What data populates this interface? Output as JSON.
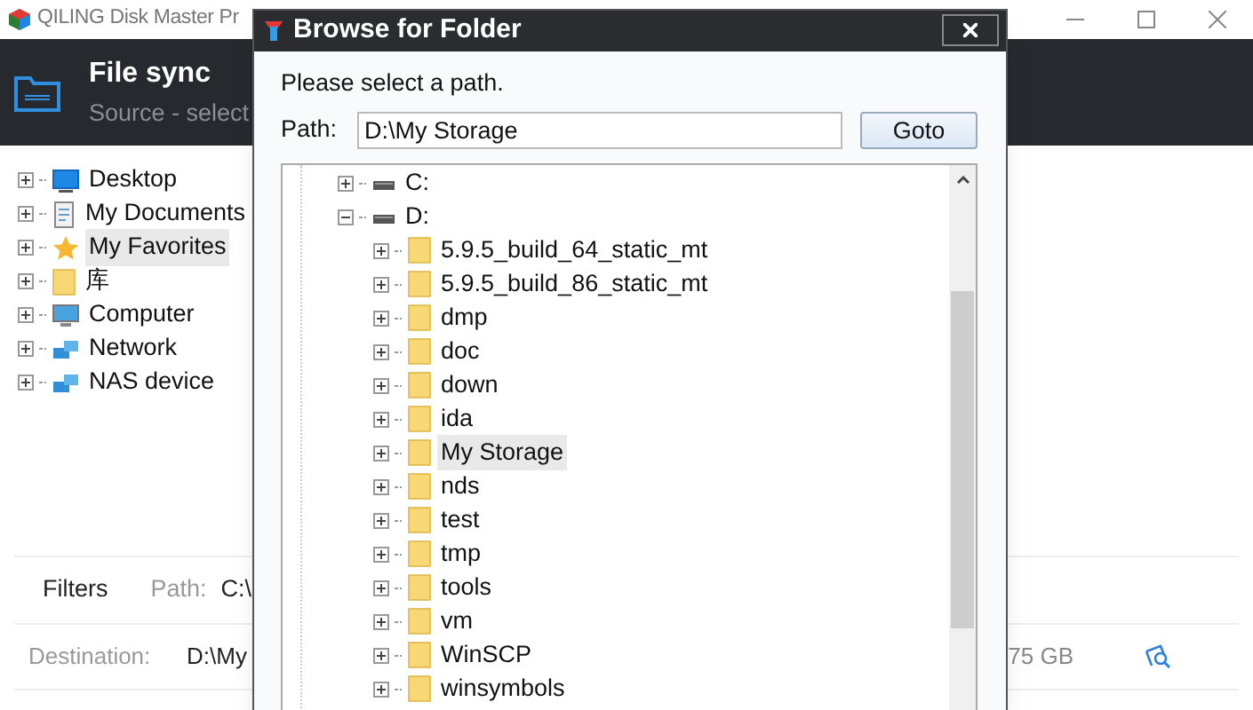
{
  "app_window": {
    "title": "QILING Disk Master Pr",
    "header": {
      "title": "File sync",
      "subtitle": "Source - select"
    },
    "tree": [
      {
        "label": "Desktop",
        "kind": "desktop",
        "expanded": false,
        "selected": false
      },
      {
        "label": "My Documents",
        "kind": "documents",
        "expanded": false,
        "selected": false
      },
      {
        "label": "My Favorites",
        "kind": "favorites",
        "expanded": false,
        "selected": true
      },
      {
        "label": "库",
        "kind": "folder",
        "expanded": false,
        "selected": false
      },
      {
        "label": "Computer",
        "kind": "computer",
        "expanded": false,
        "selected": false
      },
      {
        "label": "Network",
        "kind": "network",
        "expanded": false,
        "selected": false
      },
      {
        "label": "NAS device",
        "kind": "network",
        "expanded": false,
        "selected": false
      }
    ],
    "filters": {
      "label": "Filters",
      "path_label": "Path:",
      "path_value": "C:\\"
    },
    "destination": {
      "label": "Destination:",
      "value": "D:\\My",
      "size": "75 GB"
    }
  },
  "dialog": {
    "title": "Browse for Folder",
    "prompt": "Please select a path.",
    "path": {
      "label": "Path:",
      "value": "D:\\My Storage"
    },
    "goto_button": "Goto",
    "tree": [
      {
        "label": "C:",
        "kind": "drive",
        "expanded": false,
        "selected": false
      },
      {
        "label": "D:",
        "kind": "drive",
        "expanded": true,
        "selected": false,
        "children": [
          {
            "label": "5.9.5_build_64_static_mt",
            "kind": "folder",
            "expanded": false,
            "selected": false
          },
          {
            "label": "5.9.5_build_86_static_mt",
            "kind": "folder",
            "expanded": false,
            "selected": false
          },
          {
            "label": "dmp",
            "kind": "folder",
            "expanded": false,
            "selected": false
          },
          {
            "label": "doc",
            "kind": "folder",
            "expanded": false,
            "selected": false
          },
          {
            "label": "down",
            "kind": "folder",
            "expanded": false,
            "selected": false
          },
          {
            "label": "ida",
            "kind": "folder",
            "expanded": false,
            "selected": false
          },
          {
            "label": "My Storage",
            "kind": "folder",
            "expanded": false,
            "selected": true
          },
          {
            "label": "nds",
            "kind": "folder",
            "expanded": false,
            "selected": false
          },
          {
            "label": "test",
            "kind": "folder",
            "expanded": false,
            "selected": false
          },
          {
            "label": "tmp",
            "kind": "folder",
            "expanded": false,
            "selected": false
          },
          {
            "label": "tools",
            "kind": "folder",
            "expanded": false,
            "selected": false
          },
          {
            "label": "vm",
            "kind": "folder",
            "expanded": false,
            "selected": false
          },
          {
            "label": "WinSCP",
            "kind": "folder",
            "expanded": false,
            "selected": false
          },
          {
            "label": "winsymbols",
            "kind": "folder",
            "expanded": false,
            "selected": false
          }
        ]
      }
    ]
  }
}
